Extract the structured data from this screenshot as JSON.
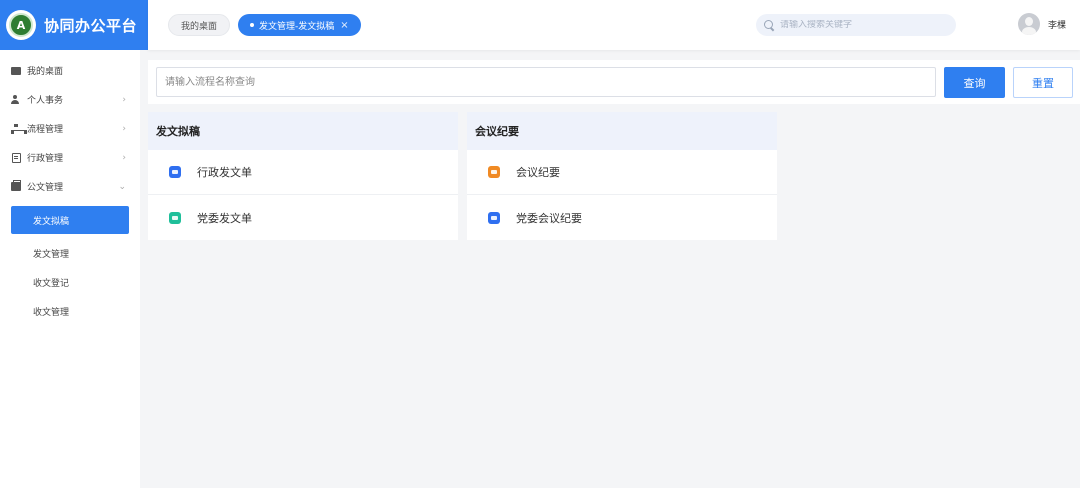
{
  "brand": {
    "title": "协同办公平台",
    "logo_text": "A"
  },
  "header": {
    "tabs": [
      {
        "label": "我的桌面"
      },
      {
        "label": "发文管理-发文拟稿",
        "close": "×"
      }
    ],
    "search_placeholder": "请输入搜索关键字",
    "user_name": "李棵"
  },
  "sidebar": {
    "items": [
      {
        "label": "我的桌面",
        "icon": "desktop-icon"
      },
      {
        "label": "个人事务",
        "icon": "person-icon",
        "arrow": "›"
      },
      {
        "label": "流程管理",
        "icon": "flow-icon",
        "arrow": "›"
      },
      {
        "label": "行政管理",
        "icon": "admin-icon",
        "arrow": "›"
      },
      {
        "label": "公文管理",
        "icon": "document-icon",
        "arrow": "⌄"
      }
    ],
    "sub_items": [
      {
        "label": "发文拟稿",
        "active": true
      },
      {
        "label": "发文管理"
      },
      {
        "label": "收文登记"
      },
      {
        "label": "收文管理"
      }
    ]
  },
  "filter": {
    "placeholder": "请输入流程名称查询",
    "query_label": "查询",
    "reset_label": "重置"
  },
  "cards": [
    {
      "title": "发文拟稿",
      "rows": [
        {
          "label": "行政发文单",
          "color": "#2f6ff0"
        },
        {
          "label": "党委发文单",
          "color": "#1fbf9a"
        }
      ]
    },
    {
      "title": "会议纪要",
      "rows": [
        {
          "label": "会议纪要",
          "color": "#f08a24"
        },
        {
          "label": "党委会议纪要",
          "color": "#2f6ff0"
        }
      ]
    }
  ],
  "colors": {
    "accent": "#2f7ff0",
    "header_bg": "#ffffff",
    "page_bg": "#f4f5f7"
  }
}
